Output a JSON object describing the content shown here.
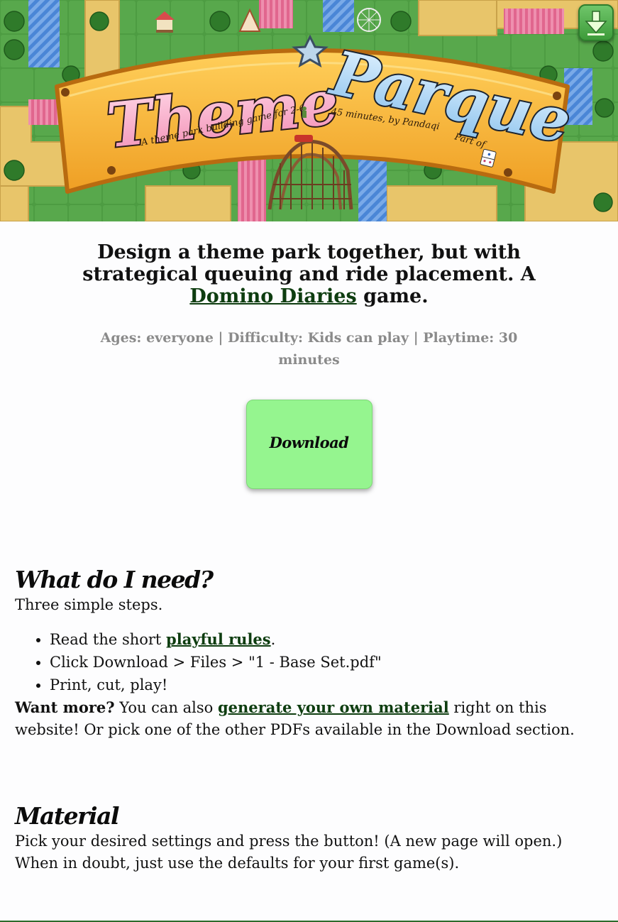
{
  "header": {
    "title_word_1": "Theme",
    "title_word_2": "Parque",
    "subtitle": "A theme park building game for 2-6",
    "subtitle_2": "45 minutes, by Pandaqi",
    "part_of": "Part of",
    "colors": {
      "grass": "#4a9a3e",
      "path": "#e9c46a",
      "banner": "#f6b73c",
      "pink_title": "#f4b6d0",
      "blue_title": "#bfe0f5"
    }
  },
  "corner_download": {
    "icon": "download-arrow-icon"
  },
  "intro": {
    "tagline_before": "Design a theme park together, but with strategical queuing and ride placement. A ",
    "tagline_link": "Domino Diaries",
    "tagline_after": " game.",
    "meta": "Ages: everyone | Difficulty: Kids can play | Playtime: 30 minutes"
  },
  "download_button": {
    "label": "Download",
    "color": "#95f58f"
  },
  "need_section": {
    "heading": "What do I need?",
    "intro": "Three simple steps.",
    "steps": [
      {
        "before": "Read the short ",
        "link": "playful rules",
        "after": "."
      },
      {
        "text": "Click Download > Files > \"1 - Base Set.pdf\""
      },
      {
        "text": "Print, cut, play!"
      }
    ],
    "more_bold": "Want more?",
    "more_before": " You can also ",
    "more_link": "generate your own material",
    "more_after": " right on this website! Or pick one of the other PDFs available in the Download section."
  },
  "material_section": {
    "heading": "Material",
    "intro": "Pick your desired settings and press the button! (A new page will open.) When in doubt, just use the defaults for your first game(s)."
  }
}
